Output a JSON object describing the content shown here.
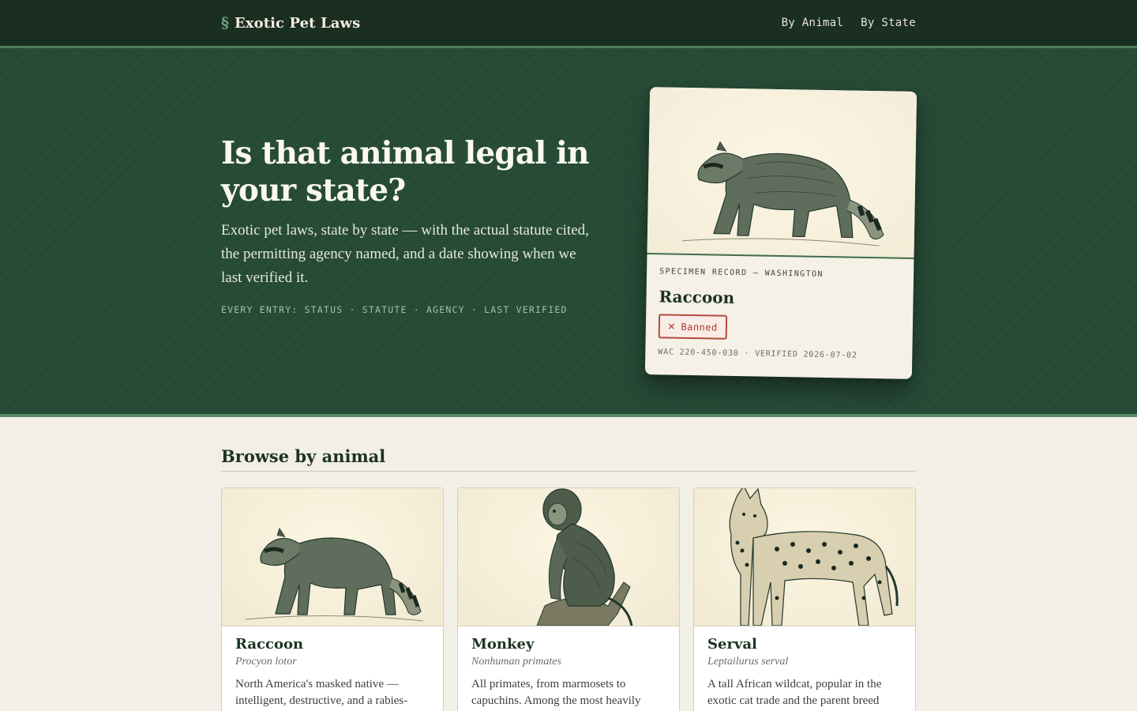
{
  "nav": {
    "brand_mark": "§",
    "brand_name": "Exotic Pet Laws",
    "links": [
      "By Animal",
      "By State"
    ]
  },
  "hero": {
    "title": "Is that animal legal in your state?",
    "subtitle": "Exotic pet laws, state by state — with the actual statute cited, the permitting agency named, and a date showing when we last verified it.",
    "meta": "EVERY ENTRY: STATUS · STATUTE · AGENCY · LAST VERIFIED"
  },
  "specimen": {
    "label": "SPECIMEN RECORD — WASHINGTON",
    "animal": "Raccoon",
    "status": "Banned",
    "status_icon": "close-icon",
    "statute": "WAC 220-450-030",
    "verified": "VERIFIED 2026-07-02",
    "status_color": "#b34a40"
  },
  "browse": {
    "heading": "Browse by animal",
    "cards": [
      {
        "name": "Raccoon",
        "scientific": "Procyon lotor",
        "description": "North America's masked native — intelligent, destructive, and a rabies-"
      },
      {
        "name": "Monkey",
        "scientific": "Nonhuman primates",
        "description": "All primates, from marmosets to capuchins. Among the most heavily"
      },
      {
        "name": "Serval",
        "scientific": "Leptailurus serval",
        "description": "A tall African wildcat, popular in the exotic cat trade and the parent breed"
      }
    ]
  },
  "colors": {
    "nav_bg": "#1a2e21",
    "hero_bg": "#264a36",
    "accent": "#5b8a67",
    "page_bg": "#f2efe6"
  }
}
